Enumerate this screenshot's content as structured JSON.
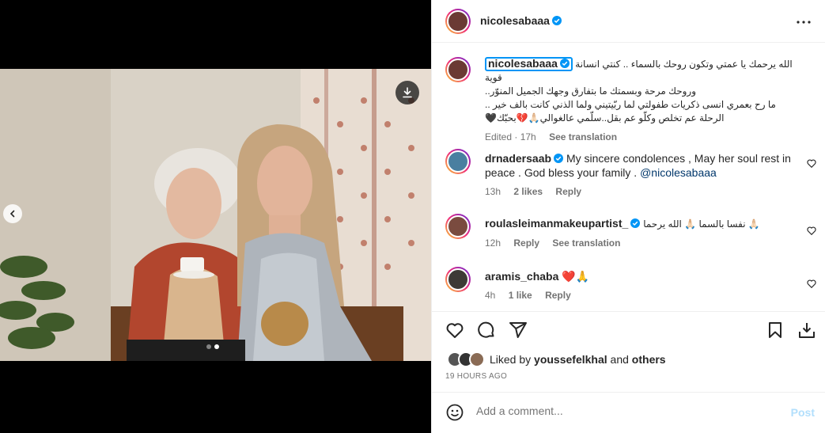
{
  "post": {
    "author": "nicolesabaaa",
    "more_icon": "more-horizontal-icon"
  },
  "caption": {
    "author": "nicolesabaaa",
    "lines": [
      "الله يرحمك يا عمتي وتكون روحك بالسماء .. كنتي انسانة قوية",
      "وروحك مرحة وبسمتك ما بتفارق وجهك الجميل المنوّر..",
      "ما رح بعمري انسى ذكريات طفولتي لما ربّيتيني ولما الذني كانت بالف خير ..",
      "الرحلة عم تخلص وكلّو عم بقل..سلّمي عالغوالي🙏🏻💔بحبّك🖤"
    ],
    "meta": {
      "time": "Edited · 17h",
      "translate": "See translation"
    }
  },
  "comments": [
    {
      "author": "drnadersaab",
      "text": "My sincere condolences , May her soul rest in peace . God bless your family . ",
      "mention": "@nicolesabaaa",
      "time": "13h",
      "likes": "2 likes",
      "reply": "Reply"
    },
    {
      "author": "roulasleimanmakeupartist_",
      "text": "نفسا بالسما 🙏🏻 الله يرحما 🙏🏻",
      "time": "12h",
      "reply": "Reply",
      "translate": "See translation"
    },
    {
      "author": "aramis_chaba",
      "text": "❤️🙏",
      "time": "4h",
      "likes": "1 like",
      "reply": "Reply"
    }
  ],
  "liked_by": {
    "prefix": "Liked by ",
    "user": "youssefelkhal",
    "mid": " and ",
    "others": "others"
  },
  "timestamp": "19 HOURS AGO",
  "add_comment": {
    "placeholder": "Add a comment...",
    "post": "Post"
  },
  "colors": {
    "accent": "#0095f6",
    "verified": "#0095f6",
    "muted": "#737373",
    "post_disabled": "#b2dffc"
  }
}
